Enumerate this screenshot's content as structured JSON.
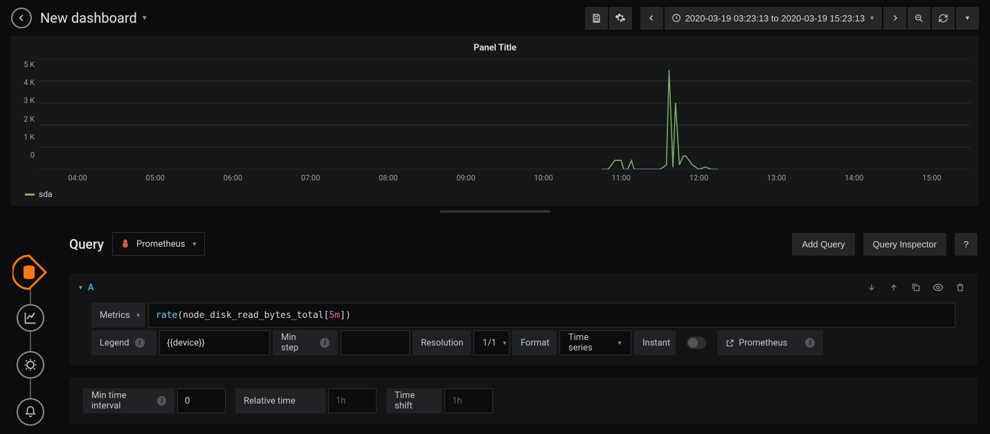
{
  "header": {
    "title": "New dashboard",
    "time_range": "2020-03-19 03:23:13 to 2020-03-19 15:23:13"
  },
  "panel": {
    "title": "Panel Title",
    "legend_series": "sda"
  },
  "chart_data": {
    "type": "line",
    "title": "Panel Title",
    "xlabel": "",
    "ylabel": "",
    "ylim": [
      0,
      5000
    ],
    "y_ticks": [
      "5 K",
      "4 K",
      "3 K",
      "2 K",
      "1 K",
      "0"
    ],
    "x_ticks": [
      "04:00",
      "05:00",
      "06:00",
      "07:00",
      "08:00",
      "09:00",
      "10:00",
      "11:00",
      "12:00",
      "13:00",
      "14:00",
      "15:00"
    ],
    "series": [
      {
        "name": "sda",
        "color": "#7eb26d",
        "x": [
          "10:45",
          "10:50",
          "10:55",
          "11:00",
          "11:02",
          "11:05",
          "11:08",
          "11:10",
          "11:20",
          "11:30",
          "11:35",
          "11:37",
          "11:40",
          "11:42",
          "11:45",
          "11:48",
          "11:50",
          "11:55",
          "12:00",
          "12:05",
          "12:10",
          "12:15"
        ],
        "y": [
          0,
          0,
          400,
          400,
          0,
          0,
          400,
          0,
          0,
          0,
          200,
          4500,
          100,
          3000,
          200,
          600,
          600,
          200,
          0,
          100,
          0,
          0
        ]
      }
    ]
  },
  "query": {
    "section_title": "Query",
    "datasource": "Prometheus",
    "add_query": "Add Query",
    "inspector": "Query Inspector",
    "help": "?",
    "row_id": "A",
    "metrics_label": "Metrics",
    "expr_fn": "rate",
    "expr_metric": "node_disk_read_bytes_total",
    "expr_range": "5m",
    "legend_label": "Legend",
    "legend_value": "{{device}}",
    "min_step_label": "Min step",
    "resolution_label": "Resolution",
    "resolution_value": "1/1",
    "format_label": "Format",
    "format_value": "Time series",
    "instant_label": "Instant",
    "datasource_link": "Prometheus",
    "min_interval_label": "Min time interval",
    "min_interval_value": "0",
    "relative_label": "Relative time",
    "relative_placeholder": "1h",
    "shift_label": "Time shift",
    "shift_placeholder": "1h"
  }
}
